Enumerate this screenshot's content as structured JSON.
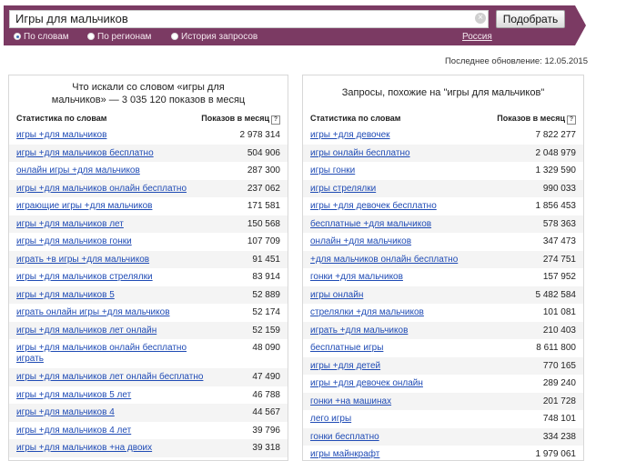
{
  "search": {
    "query": "Игры для мальчиков",
    "submit_label": "Подобрать",
    "clear_icon": "×"
  },
  "modes": [
    {
      "label": "По словам",
      "checked": true
    },
    {
      "label": "По регионам",
      "checked": false
    },
    {
      "label": "История запросов",
      "checked": false
    }
  ],
  "region": "Россия",
  "updated": "Последнее обновление: 12.05.2015",
  "left_panel": {
    "title_line1": "Что искали со словом «игры для",
    "title_line2": "мальчиков» — 3 035 120 показов в месяц",
    "col_keyword": "Статистика по словам",
    "col_shows": "Показов в месяц",
    "rows": [
      {
        "kw": "игры +для мальчиков",
        "num": "2 978 314"
      },
      {
        "kw": "игры +для мальчиков бесплатно",
        "num": "504 906"
      },
      {
        "kw": "онлайн игры +для мальчиков",
        "num": "287 300"
      },
      {
        "kw": "игры +для мальчиков онлайн бесплатно",
        "num": "237 062"
      },
      {
        "kw": "играющие игры +для мальчиков",
        "num": "171 581"
      },
      {
        "kw": "игры +для мальчиков лет",
        "num": "150 568"
      },
      {
        "kw": "игры +для мальчиков гонки",
        "num": "107 709"
      },
      {
        "kw": "играть +в игры +для мальчиков",
        "num": "91 451"
      },
      {
        "kw": "игры +для мальчиков стрелялки",
        "num": "83 914"
      },
      {
        "kw": "игры +для мальчиков 5",
        "num": "52 889"
      },
      {
        "kw": "играть онлайн игры +для мальчиков",
        "num": "52 174"
      },
      {
        "kw": "игры +для мальчиков лет онлайн",
        "num": "52 159"
      },
      {
        "kw": "игры +для мальчиков онлайн бесплатно играть",
        "num": "48 090"
      },
      {
        "kw": "игры +для мальчиков лет онлайн бесплатно",
        "num": "47 490"
      },
      {
        "kw": "игры +для мальчиков 5 лет",
        "num": "46 788"
      },
      {
        "kw": "игры +для мальчиков 4",
        "num": "44 567"
      },
      {
        "kw": "игры +для мальчиков 4 лет",
        "num": "39 796"
      },
      {
        "kw": "игры +для мальчиков +на двоих",
        "num": "39 318"
      }
    ]
  },
  "right_panel": {
    "title": "Запросы, похожие на \"игры для мальчиков\"",
    "col_keyword": "Статистика по словам",
    "col_shows": "Показов в месяц",
    "rows": [
      {
        "kw": "игры +для девочек",
        "num": "7 822 277"
      },
      {
        "kw": "игры онлайн бесплатно",
        "num": "2 048 979"
      },
      {
        "kw": "игры гонки",
        "num": "1 329 590"
      },
      {
        "kw": "игры стрелялки",
        "num": "990 033"
      },
      {
        "kw": "игры +для девочек бесплатно",
        "num": "1 856 453"
      },
      {
        "kw": "бесплатные +для мальчиков",
        "num": "578 363"
      },
      {
        "kw": "онлайн +для мальчиков",
        "num": "347 473"
      },
      {
        "kw": "+для мальчиков онлайн бесплатно",
        "num": "274 751"
      },
      {
        "kw": "гонки +для мальчиков",
        "num": "157 952"
      },
      {
        "kw": "игры онлайн",
        "num": "5 482 584"
      },
      {
        "kw": "стрелялки +для мальчиков",
        "num": "101 081"
      },
      {
        "kw": "играть +для мальчиков",
        "num": "210 403"
      },
      {
        "kw": "бесплатные игры",
        "num": "8 611 800"
      },
      {
        "kw": "игры +для детей",
        "num": "770 165"
      },
      {
        "kw": "игры +для девочек онлайн",
        "num": "289 240"
      },
      {
        "kw": "гонки +на машинах",
        "num": "201 728"
      },
      {
        "kw": "лего игры",
        "num": "748 101"
      },
      {
        "kw": "гонки бесплатно",
        "num": "334 238"
      },
      {
        "kw": "игры майнкрафт",
        "num": "1 979 061"
      }
    ]
  }
}
